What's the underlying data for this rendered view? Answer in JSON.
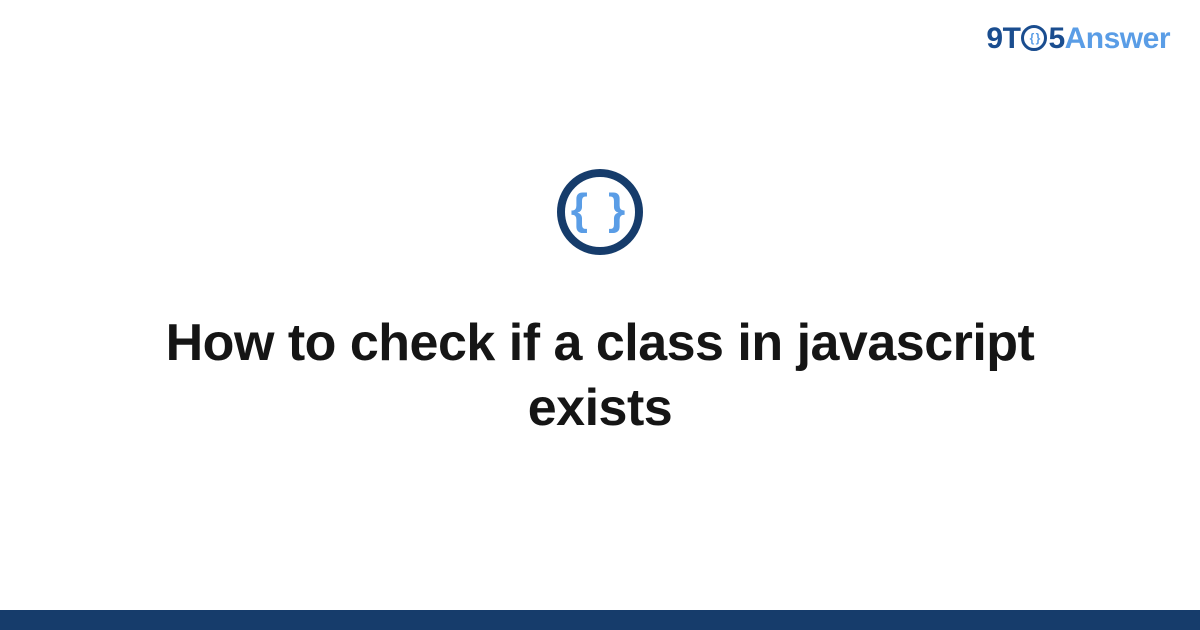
{
  "logo": {
    "part1": "9T",
    "inner": "{ }",
    "part2": "5",
    "part3": "Answer"
  },
  "icon": {
    "symbol": "{ }"
  },
  "title": "How to check if a class in javascript exists",
  "colors": {
    "primary_dark": "#163c6b",
    "primary_light": "#5a9de6",
    "text": "#151515"
  }
}
